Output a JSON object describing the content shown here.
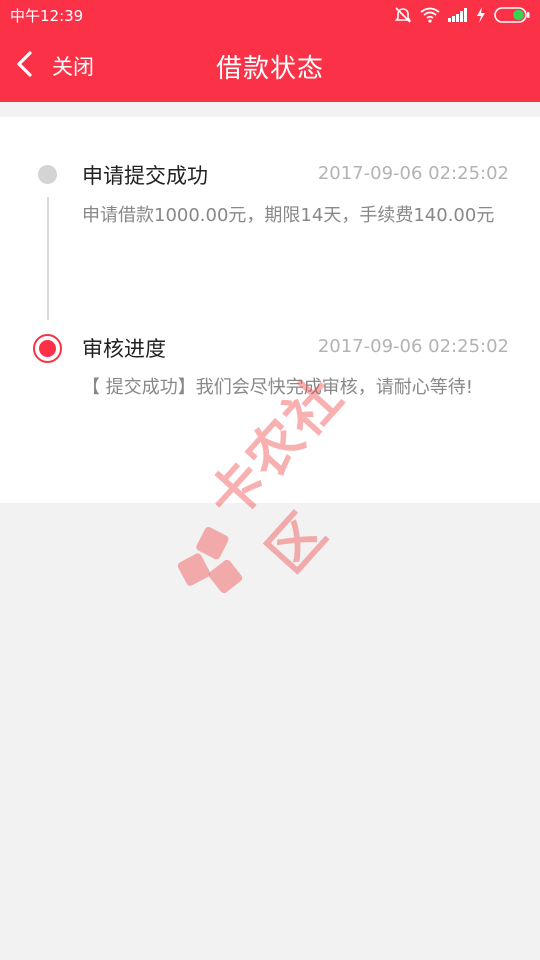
{
  "status_bar": {
    "time": "中午12:39"
  },
  "nav": {
    "back_label": "关闭",
    "title": "借款状态"
  },
  "timeline": [
    {
      "title": "申请提交成功",
      "time": "2017-09-06 02:25:02",
      "desc": "申请借款1000.00元，期限14天，手续费140.00元",
      "state": "done"
    },
    {
      "title": "审核进度",
      "time": "2017-09-06 02:25:02",
      "desc": "【 提交成功】我们会尽快完成审核，请耐心等待!",
      "state": "current"
    }
  ],
  "watermark": {
    "text": "卡农社区"
  },
  "colors": {
    "brand": "#fb3247",
    "background": "#f2f2f2",
    "muted_text": "#888888",
    "time_text": "#b3b3b3"
  }
}
